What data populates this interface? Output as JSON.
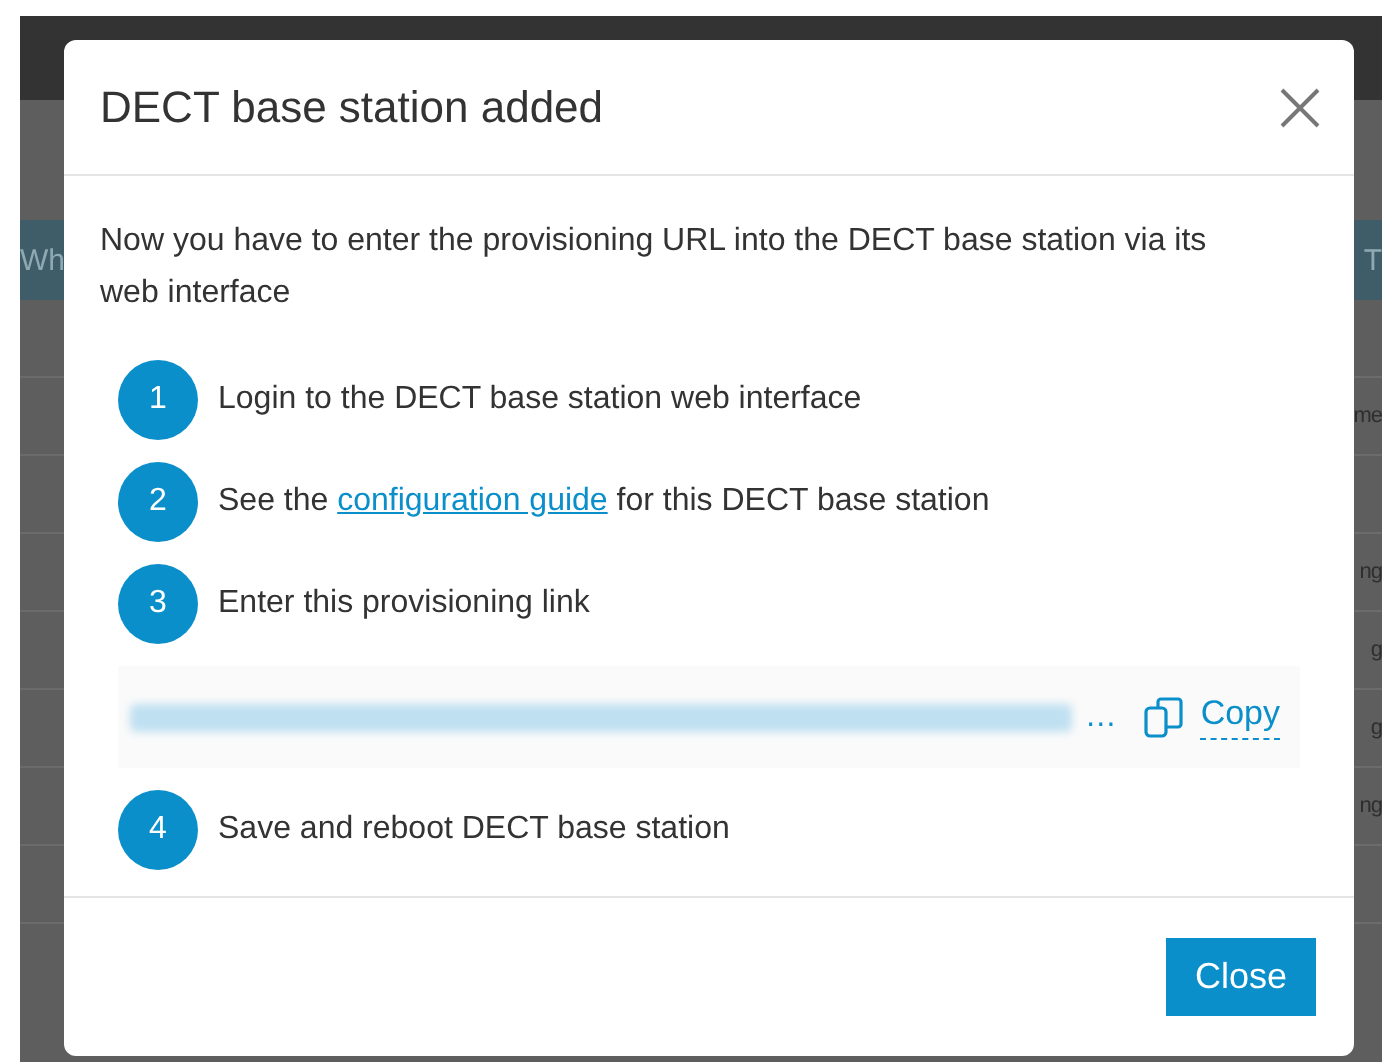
{
  "background": {
    "header_left": "Wh",
    "header_right": "T",
    "right_cells": [
      "",
      "me",
      "",
      "ng",
      "g",
      "g",
      "ng",
      ""
    ]
  },
  "dialog": {
    "title": "DECT base station added",
    "intro": "Now you have to enter the provisioning URL into the DECT base station via its web interface",
    "steps": [
      {
        "kind": "step",
        "number": "1",
        "text": "Login to the DECT base station web interface"
      },
      {
        "kind": "step_link",
        "number": "2",
        "before": "See the ",
        "link": "configuration guide",
        "after": " for this DECT base station"
      },
      {
        "kind": "step",
        "number": "3",
        "text": "Enter this provisioning link"
      },
      {
        "kind": "copy_link",
        "ellipsis": "…",
        "copy": "Copy"
      },
      {
        "kind": "step",
        "number": "4",
        "text": "Save and reboot DECT base station"
      }
    ],
    "button": "Close"
  }
}
